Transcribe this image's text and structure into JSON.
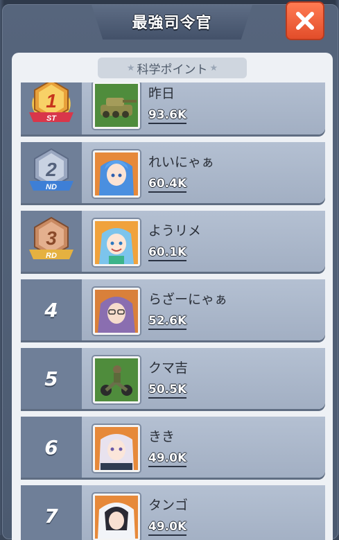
{
  "header": {
    "title": "最強司令官",
    "close_icon": "close-icon"
  },
  "subtitle": "科学ポイント",
  "ranking": [
    {
      "rank": "1",
      "suffix": "ST",
      "name": "昨日",
      "score": "93.6K",
      "avatar": "tank-avatar",
      "badge_color": "#e8a13a"
    },
    {
      "rank": "2",
      "suffix": "ND",
      "name": "れいにゃぁ",
      "score": "60.4K",
      "avatar": "blue-hair-girl-avatar",
      "badge_color": "#9aa7c0"
    },
    {
      "rank": "3",
      "suffix": "RD",
      "name": "ようリメ",
      "score": "60.1K",
      "avatar": "aqua-girl-avatar",
      "badge_color": "#c98a62"
    },
    {
      "rank": "4",
      "name": "らざーにゃぁ",
      "score": "52.6K",
      "avatar": "purple-hair-girl-avatar"
    },
    {
      "rank": "5",
      "name": "クマ吉",
      "score": "50.5K",
      "avatar": "motorbike-soldier-avatar"
    },
    {
      "rank": "6",
      "name": "きき",
      "score": "49.0K",
      "avatar": "white-hair-girl-avatar"
    },
    {
      "rank": "7",
      "name": "タンゴ",
      "score": "49.0K",
      "avatar": "hooded-girl-avatar"
    }
  ],
  "colors": {
    "accent_close": "#e24d2a",
    "row_bg": "#a9b5c8",
    "rank_col": "#6f7f98"
  }
}
